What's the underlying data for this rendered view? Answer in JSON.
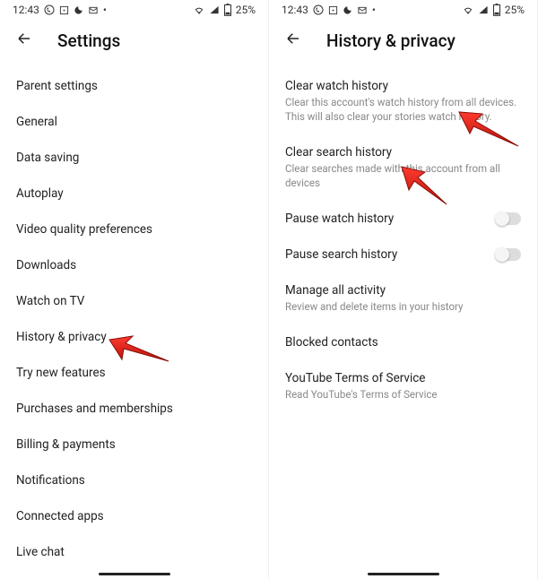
{
  "statusbar": {
    "time": "12:43",
    "battery": "25%"
  },
  "left": {
    "title": "Settings",
    "items": [
      {
        "label": "Parent settings"
      },
      {
        "label": "General"
      },
      {
        "label": "Data saving"
      },
      {
        "label": "Autoplay"
      },
      {
        "label": "Video quality preferences"
      },
      {
        "label": "Downloads"
      },
      {
        "label": "Watch on TV"
      },
      {
        "label": "History & privacy"
      },
      {
        "label": "Try new features"
      },
      {
        "label": "Purchases and memberships"
      },
      {
        "label": "Billing & payments"
      },
      {
        "label": "Notifications"
      },
      {
        "label": "Connected apps"
      },
      {
        "label": "Live chat"
      }
    ]
  },
  "right": {
    "title": "History & privacy",
    "items": [
      {
        "label": "Clear watch history",
        "subtitle": "Clear this account's watch history from all devices. This will also clear your stories watch history."
      },
      {
        "label": "Clear search history",
        "subtitle": "Clear searches made with this account from all devices"
      },
      {
        "label": "Pause watch history",
        "toggle": true
      },
      {
        "label": "Pause search history",
        "toggle": true
      },
      {
        "label": "Manage all activity",
        "subtitle": "Review and delete items in your history"
      },
      {
        "label": "Blocked contacts"
      },
      {
        "label": "YouTube Terms of Service",
        "subtitle": "Read YouTube's Terms of Service"
      }
    ]
  }
}
